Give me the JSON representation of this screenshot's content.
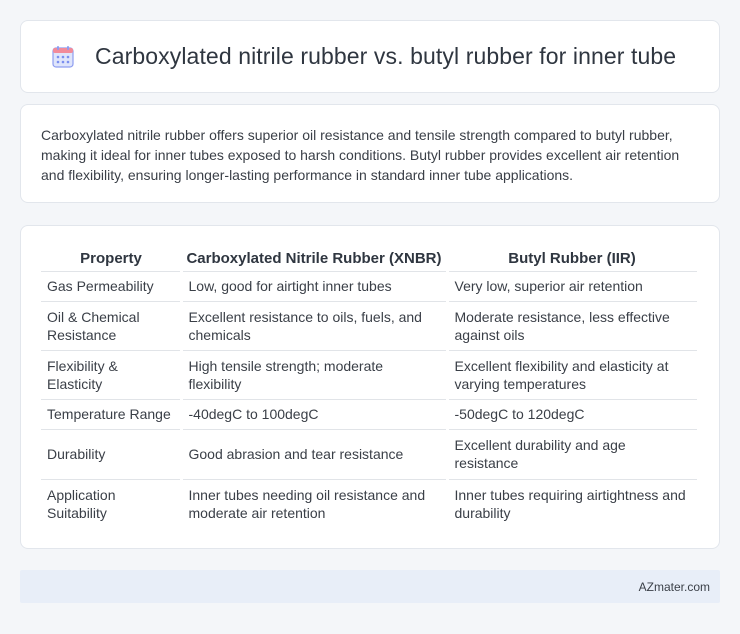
{
  "header": {
    "title": "Carboxylated nitrile rubber vs. butyl rubber for inner tube",
    "icon": "calendar-icon",
    "icon_color": "#7b8ff0"
  },
  "summary": {
    "text": "Carboxylated nitrile rubber offers superior oil resistance and tensile strength compared to butyl rubber, making it ideal for inner tubes exposed to harsh conditions. Butyl rubber provides excellent air retention and flexibility, ensuring longer-lasting performance in standard inner tube applications."
  },
  "table": {
    "headers": [
      "Property",
      "Carboxylated Nitrile Rubber (XNBR)",
      "Butyl Rubber (IIR)"
    ],
    "rows": [
      [
        "Gas Permeability",
        "Low, good for airtight inner tubes",
        "Very low, superior air retention"
      ],
      [
        "Oil & Chemical Resistance",
        "Excellent resistance to oils, fuels, and chemicals",
        "Moderate resistance, less effective against oils"
      ],
      [
        "Flexibility & Elasticity",
        "High tensile strength; moderate flexibility",
        "Excellent flexibility and elasticity at varying temperatures"
      ],
      [
        "Temperature Range",
        "-40degC to 100degC",
        "-50degC to 120degC"
      ],
      [
        "Durability",
        "Good abrasion and tear resistance",
        "Excellent durability and age resistance"
      ],
      [
        "Application Suitability",
        "Inner tubes needing oil resistance and moderate air retention",
        "Inner tubes requiring airtightness and durability"
      ]
    ]
  },
  "footer": {
    "brand": "AZmater.com"
  }
}
